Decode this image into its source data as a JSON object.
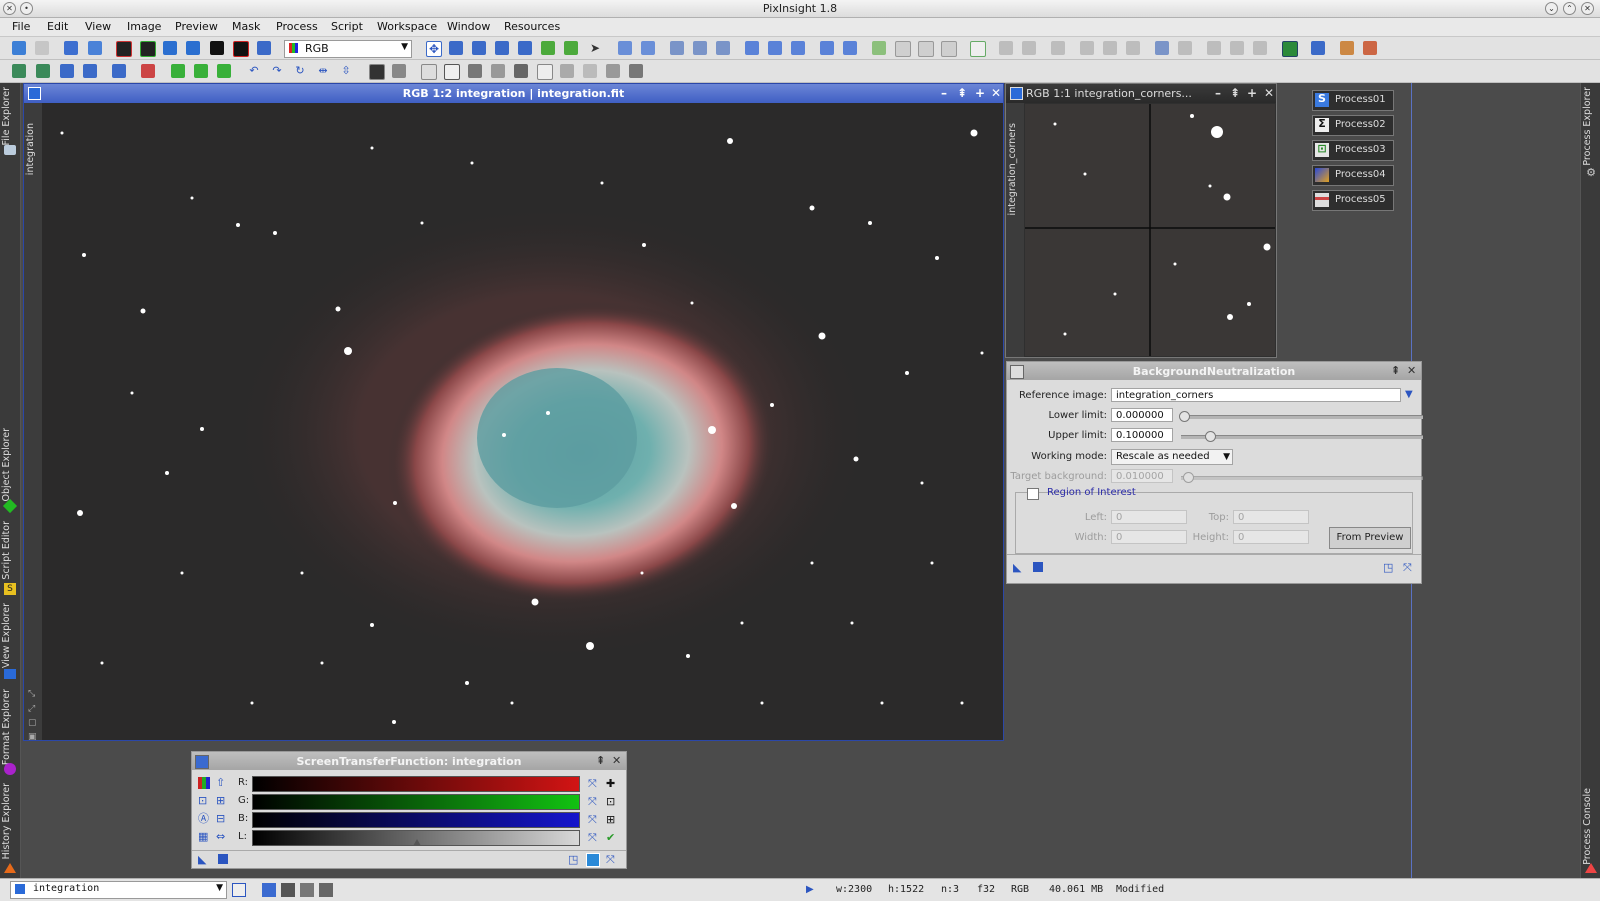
{
  "app_title": "PixInsight 1.8",
  "menu": [
    "File",
    "Edit",
    "View",
    "Image",
    "Preview",
    "Mask",
    "Process",
    "Script",
    "Workspace",
    "Window",
    "Resources"
  ],
  "toolbar": {
    "color_mode": "RGB"
  },
  "left_tabs": [
    "File Explorer",
    "Object Explorer",
    "Script Editor",
    "View Explorer",
    "Format Explorer",
    "History Explorer"
  ],
  "right_tabs": [
    "Process Explorer",
    "Process Console"
  ],
  "main_window": {
    "title": "RGB 1:2 integration | integration.fit",
    "side_label": "integration"
  },
  "preview_window": {
    "title": "RGB 1:1 integration_corners...",
    "side_label": "integration_corners"
  },
  "process_icons": [
    "Process01",
    "Process02",
    "Process03",
    "Process04",
    "Process05"
  ],
  "background_neutralization": {
    "title": "BackgroundNeutralization",
    "reference_image_label": "Reference image:",
    "reference_image": "integration_corners",
    "lower_limit_label": "Lower limit:",
    "lower_limit": "0.000000",
    "lower_limit_level": 0.0,
    "upper_limit_label": "Upper limit:",
    "upper_limit": "0.100000",
    "upper_limit_level": 0.1,
    "working_mode_label": "Working mode:",
    "working_mode": "Rescale as needed",
    "target_background_label": "Target background:",
    "target_background": "0.010000",
    "target_background_level": 0.01,
    "roi_label": "Region of Interest",
    "roi_checked": false,
    "left_label": "Left:",
    "left": "0",
    "top_label": "Top:",
    "top": "0",
    "width_label": "Width:",
    "width": "0",
    "height_label": "Height:",
    "height": "0",
    "from_preview": "From Preview"
  },
  "stf": {
    "title": "ScreenTransferFunction: integration",
    "channels": [
      "R:",
      "G:",
      "B:",
      "L:"
    ],
    "colors": {
      "R": "#d21414",
      "G": "#12c212",
      "B": "#1515cc",
      "L": "#d8d8d8"
    },
    "l_midtone_level": 0.5
  },
  "status": {
    "view": "integration",
    "width": "w:2300",
    "height": "h:1522",
    "channels": "n:3",
    "format": "f32",
    "colorspace": "RGB",
    "size": "40.061 MB",
    "state": "Modified"
  }
}
